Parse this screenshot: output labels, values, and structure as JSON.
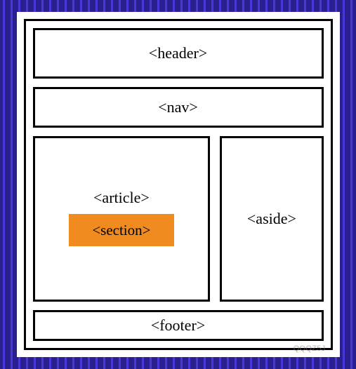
{
  "layout": {
    "header": "<header>",
    "nav": "<nav>",
    "article": "<article>",
    "section": "<section>",
    "aside": "<aside>",
    "footer": "<footer>"
  },
  "watermark": "QQQZ5J"
}
